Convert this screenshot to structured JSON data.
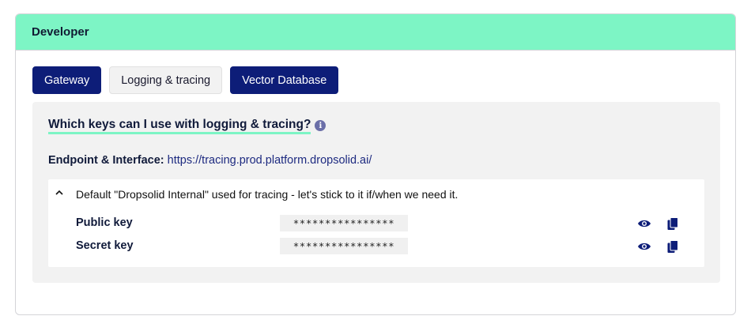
{
  "header": {
    "title": "Developer"
  },
  "tabs": [
    {
      "label": "Gateway",
      "state": "primary"
    },
    {
      "label": "Logging & tracing",
      "state": "selected"
    },
    {
      "label": "Vector Database",
      "state": "primary"
    }
  ],
  "panel": {
    "question": "Which keys can I use with logging & tracing?",
    "endpoint_label": "Endpoint & Interface:",
    "endpoint_url": "https://tracing.prod.platform.dropsolid.ai/",
    "keys_description": "Default \"Dropsolid Internal\" used for tracing - let's stick to it if/when we need it.",
    "keys": [
      {
        "label": "Public key",
        "value": "****************"
      },
      {
        "label": "Secret key",
        "value": "****************"
      }
    ]
  },
  "icons": {
    "info": "info-icon",
    "chevron": "chevron-up-icon",
    "reveal": "eye-icon",
    "copy": "copy-icon"
  },
  "colors": {
    "header_bg": "#7df5c5",
    "primary": "#0d1d78",
    "panel_bg": "#f2f2f2",
    "underline": "#7df5c5"
  }
}
